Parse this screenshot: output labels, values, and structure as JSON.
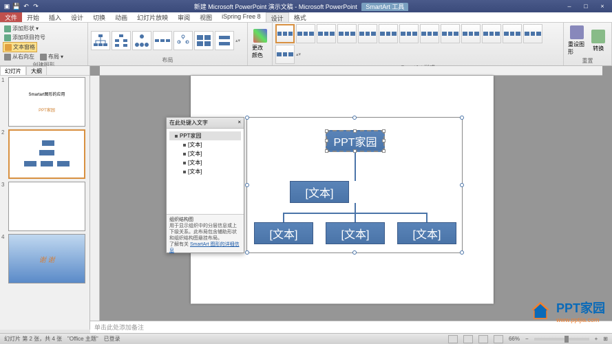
{
  "titlebar": {
    "title_left": "新建 Microsoft PowerPoint 演示文稿 - Microsoft PowerPoint",
    "contextual": "SmartArt 工具",
    "save_icon": "save-icon",
    "undo_icon": "undo-icon",
    "redo_icon": "redo-icon",
    "min": "–",
    "max": "□",
    "close": "×"
  },
  "tabs": {
    "file": "文件",
    "list": [
      "开始",
      "插入",
      "设计",
      "切换",
      "动画",
      "幻灯片放映",
      "审阅",
      "视图",
      "iSpring Free 8"
    ],
    "contextual": [
      "设计",
      "格式"
    ]
  },
  "ribbon": {
    "group_create": {
      "add_shape": "添加形状",
      "add_bullet": "添加项目符号",
      "text_pane": "文本窗格",
      "rtl": "从右向左",
      "layout": "布局",
      "label": "创建图形"
    },
    "group_layout": {
      "label": "布局"
    },
    "group_colors": {
      "change_colors": "更改颜色"
    },
    "group_styles": {
      "label": "SmartArt 样式"
    },
    "group_reset": {
      "reset": "重设图形",
      "convert": "转换",
      "label": "重置"
    }
  },
  "thumbs": {
    "tab_slides": "幻灯片",
    "tab_outline": "大纲",
    "slide1": {
      "title": "Smartart图形的应用",
      "footer": "PPT家园"
    },
    "slide2_title": "PPT家园",
    "slide4_text": "谢 谢"
  },
  "text_pane": {
    "header": "在此处键入文字",
    "close": "×",
    "items": [
      {
        "level": 0,
        "text": "PPT家园"
      },
      {
        "level": 1,
        "text": "[文本]"
      },
      {
        "level": 1,
        "text": "[文本]"
      },
      {
        "level": 1,
        "text": "[文本]"
      },
      {
        "level": 1,
        "text": "[文本]"
      }
    ],
    "desc_title": "组织结构图",
    "desc_body": "用于显示组织中的分层信息或上下级关系。此布局包含辅助形状和组织结构图悬挂布局。",
    "desc_link_prefix": "了解有关 ",
    "desc_link": "SmartArt 图形的详细信息"
  },
  "smartart": {
    "root": "PPT家园",
    "child": "[文本]",
    "leaf1": "[文本]",
    "leaf2": "[文本]",
    "leaf3": "[文本]"
  },
  "notes": {
    "placeholder": "单击此处添加备注"
  },
  "status": {
    "slide_info": "幻灯片 第 2 张，共 4 张",
    "theme": "\"Office 主题\"",
    "lang": "已登录",
    "zoom": "66%",
    "fit": "⊞"
  },
  "watermark": {
    "line1": "PPT家园",
    "line2": "www.pptjia.com"
  },
  "chart_data": {
    "type": "hierarchy",
    "title": "组织结构图",
    "nodes": [
      {
        "id": "n1",
        "text": "PPT家园",
        "parent": null
      },
      {
        "id": "n2",
        "text": "[文本]",
        "parent": "n1"
      },
      {
        "id": "n3",
        "text": "[文本]",
        "parent": "n2"
      },
      {
        "id": "n4",
        "text": "[文本]",
        "parent": "n2"
      },
      {
        "id": "n5",
        "text": "[文本]",
        "parent": "n2"
      }
    ]
  }
}
